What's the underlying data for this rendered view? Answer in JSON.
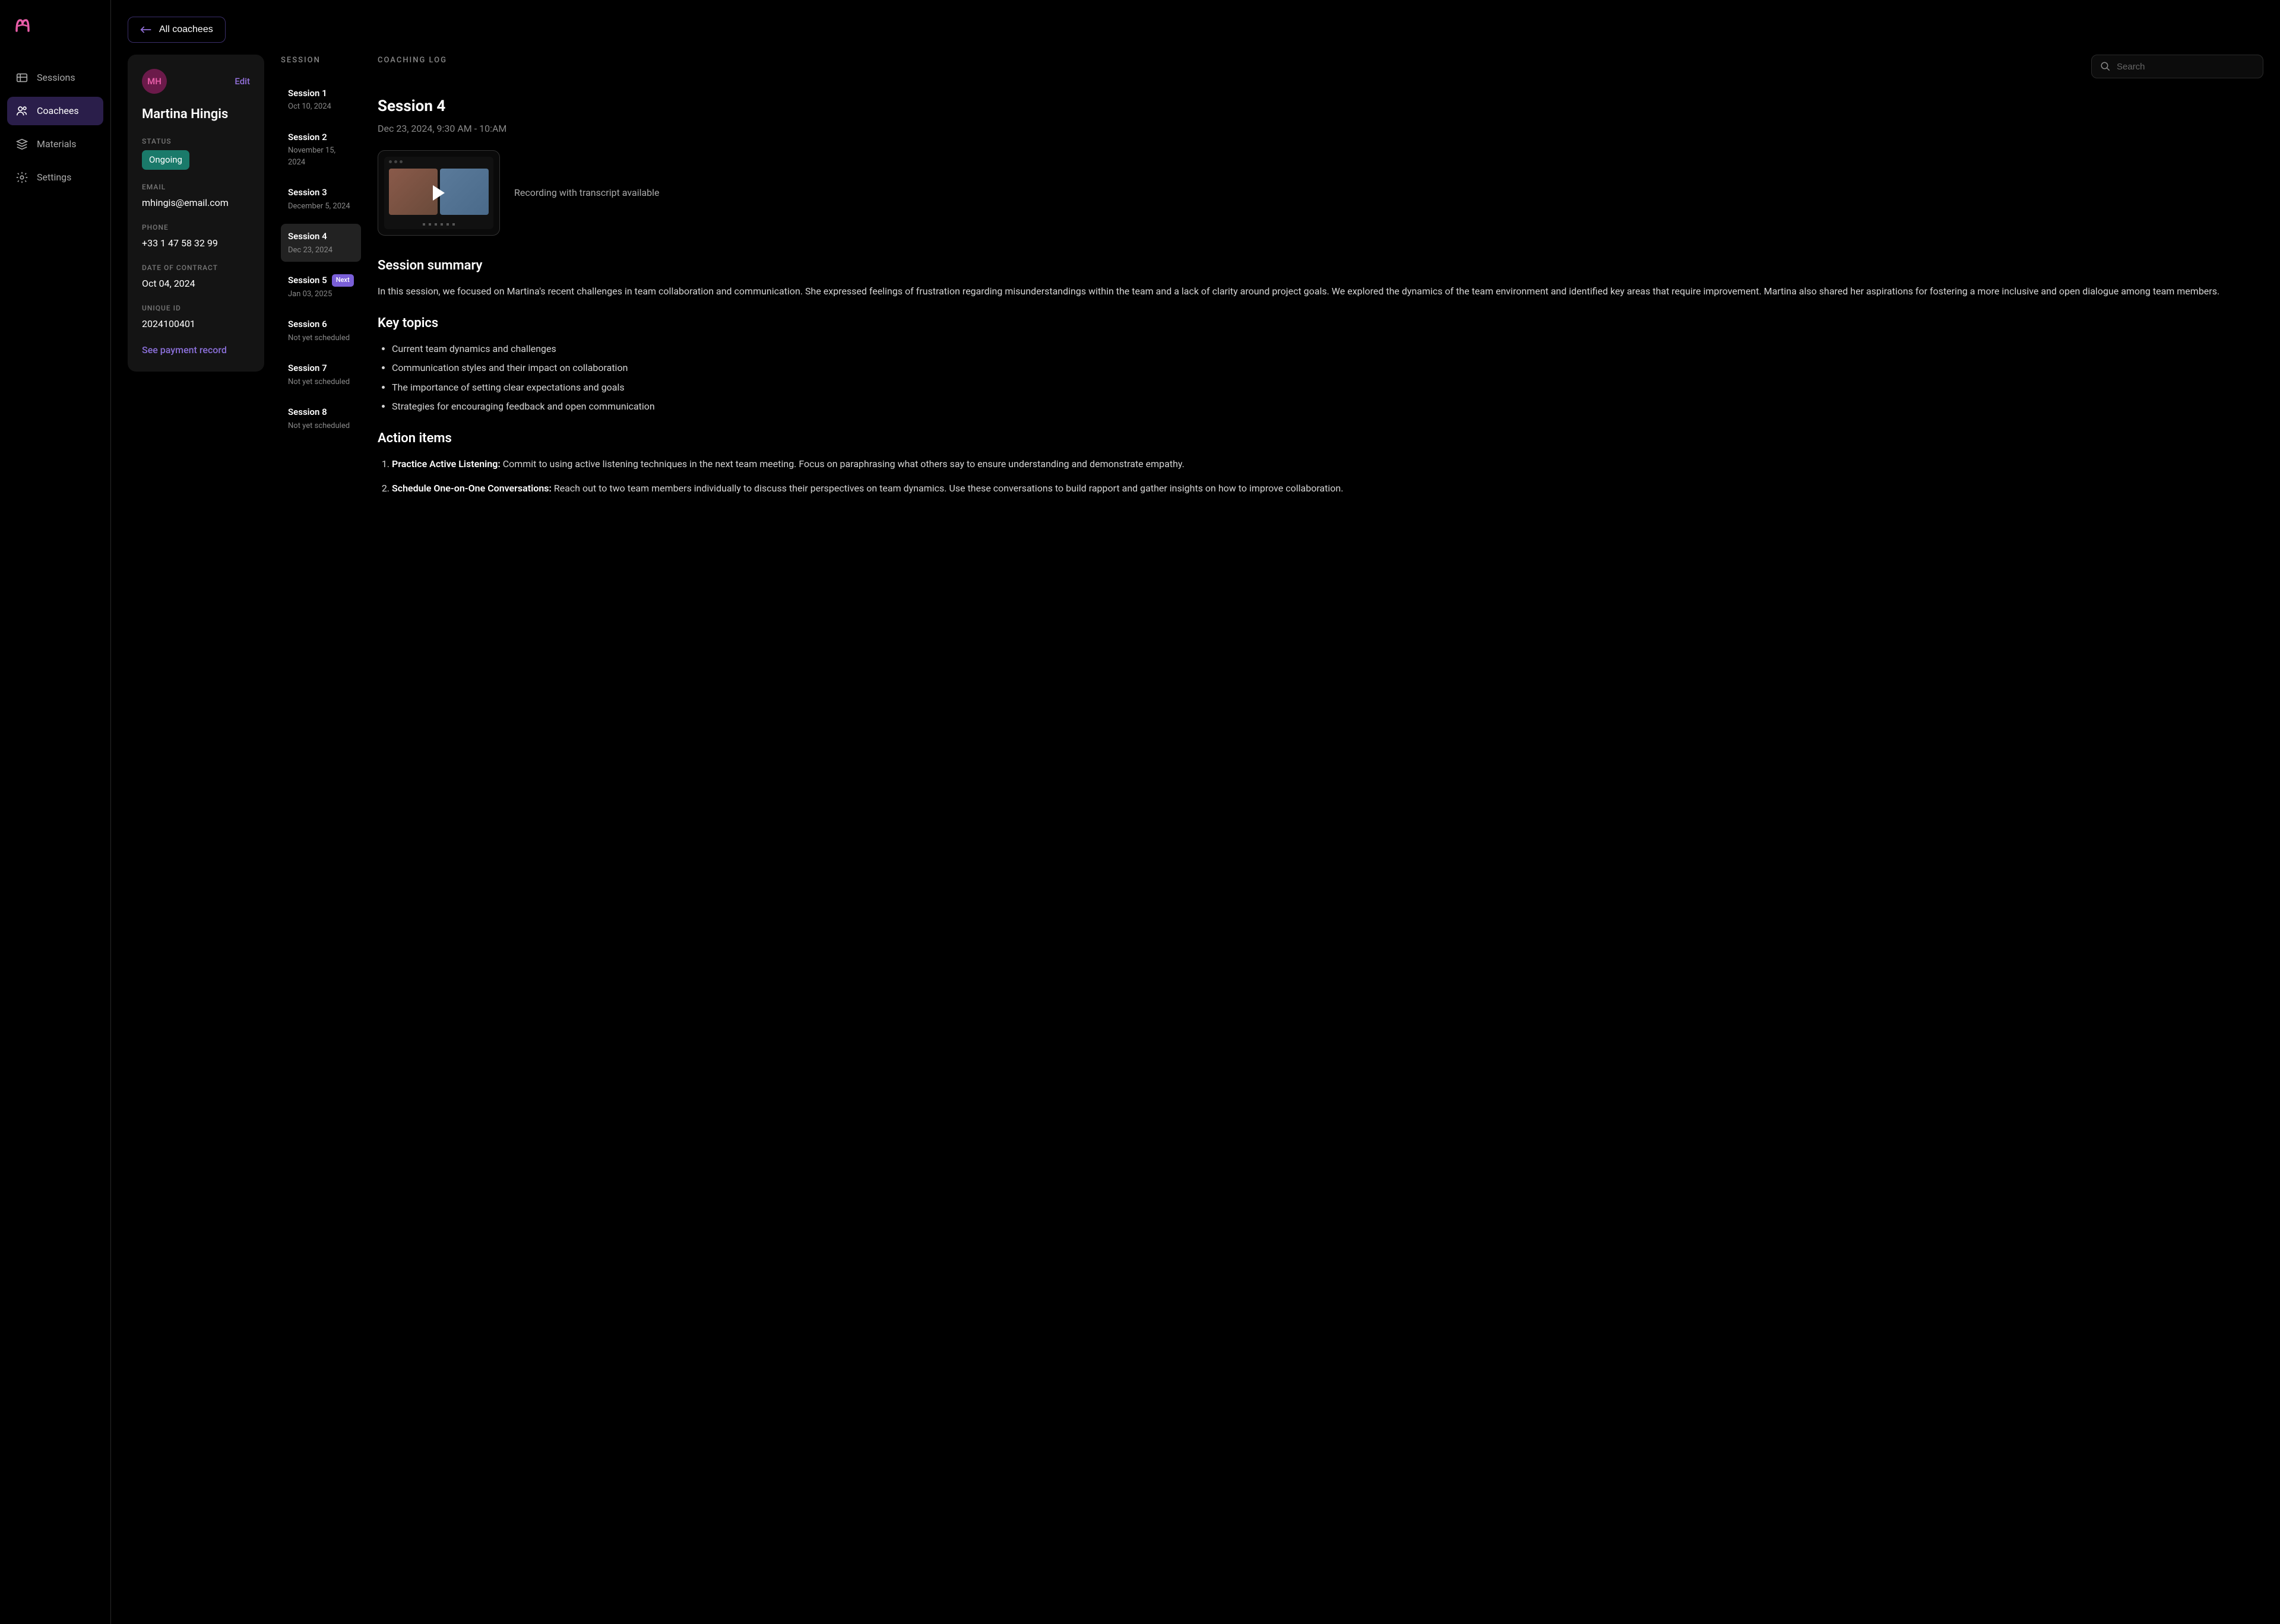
{
  "sidebar": {
    "items": [
      {
        "label": "Sessions"
      },
      {
        "label": "Coachees"
      },
      {
        "label": "Materials"
      },
      {
        "label": "Settings"
      }
    ]
  },
  "back_label": "All coachees",
  "coachee": {
    "initials": "MH",
    "edit_label": "Edit",
    "name": "Martina Hingis",
    "status_label": "STATUS",
    "status_value": "Ongoing",
    "email_label": "EMAIL",
    "email_value": "mhingis@email.com",
    "phone_label": "PHONE",
    "phone_value": "+33 1 47 58 32 99",
    "contract_label": "DATE OF CONTRACT",
    "contract_value": "Oct 04, 2024",
    "uid_label": "UNIQUE ID",
    "uid_value": "2024100401",
    "payment_link": "See payment record"
  },
  "session_col_title": "SESSION",
  "sessions": [
    {
      "title": "Session 1",
      "date": "Oct 10, 2024"
    },
    {
      "title": "Session 2",
      "date": "November 15, 2024"
    },
    {
      "title": "Session 3",
      "date": "December 5, 2024"
    },
    {
      "title": "Session 4",
      "date": "Dec 23, 2024"
    },
    {
      "title": "Session 5",
      "date": "Jan 03, 2025",
      "next": "Next"
    },
    {
      "title": "Session 6",
      "date": "Not yet scheduled"
    },
    {
      "title": "Session 7",
      "date": "Not yet scheduled"
    },
    {
      "title": "Session 8",
      "date": "Not yet scheduled"
    }
  ],
  "log": {
    "title": "COACHING LOG",
    "search_placeholder": "Search",
    "session_title": "Session 4",
    "session_time": "Dec 23, 2024, 9:30 AM - 10:AM",
    "video_caption": "Recording with transcript available",
    "summary_heading": "Session summary",
    "summary_text": "In this session, we focused on Martina's recent challenges in team collaboration and communication. She expressed feelings of frustration regarding misunderstandings within the team and a lack of clarity around project goals. We explored the dynamics of the team environment and identified key areas that require improvement. Martina also shared her aspirations for fostering a more inclusive and open dialogue among team members.",
    "topics_heading": "Key topics",
    "topics": [
      "Current team dynamics and challenges",
      "Communication styles and their impact on collaboration",
      "The importance of setting clear expectations and goals",
      "Strategies for encouraging feedback and open communication"
    ],
    "actions_heading": "Action items",
    "actions": [
      {
        "title": "Practice Active Listening:",
        "text": " Commit to using active listening techniques in the next team meeting. Focus on paraphrasing what others say to ensure understanding and demonstrate empathy."
      },
      {
        "title": "Schedule One-on-One Conversations:",
        "text": " Reach out to two team members individually to discuss their perspectives on team dynamics. Use these conversations to build rapport and gather insights on how to improve collaboration."
      }
    ]
  }
}
